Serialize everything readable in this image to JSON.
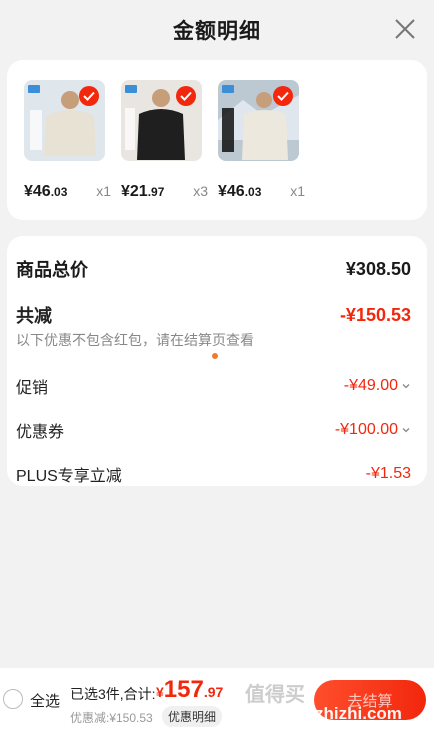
{
  "header": {
    "title": "金额明细"
  },
  "products": [
    {
      "price_int": "¥46",
      "price_dec": ".03",
      "qty": "x1",
      "bg": "#dfe6ec",
      "coat": "#e8e2d4"
    },
    {
      "price_int": "¥21",
      "price_dec": ".97",
      "qty": "x3",
      "bg": "#e9e6e2",
      "coat": "#1f1f1f"
    },
    {
      "price_int": "¥46",
      "price_dec": ".03",
      "qty": "x1",
      "bg": "#bcc8d2",
      "coat": "#ece8de"
    }
  ],
  "summary": {
    "total_label": "商品总价",
    "total_value": "¥308.50",
    "discount_label": "共减",
    "discount_value": "-¥150.53",
    "note": "以下优惠不包含红包，请在结算页查看",
    "promo_label": "促销",
    "promo_value": "-¥49.00",
    "coupon_label": "优惠券",
    "coupon_value": "-¥100.00",
    "plus_label": "PLUS专享立减",
    "plus_value": "-¥1.53"
  },
  "footer": {
    "select_all": "全选",
    "count_text": "已选3件,合计:",
    "currency": "¥",
    "amount_int": "157",
    "amount_dec": ".97",
    "saved_text": "优惠减:¥150.53",
    "detail_button": "优惠明细",
    "checkout_label": "去结算",
    "watermark_cn": "值得买",
    "watermark_url": "zhizhi.com"
  },
  "colors": {
    "accent": "#f2270c",
    "dot": "#f27a2e"
  }
}
